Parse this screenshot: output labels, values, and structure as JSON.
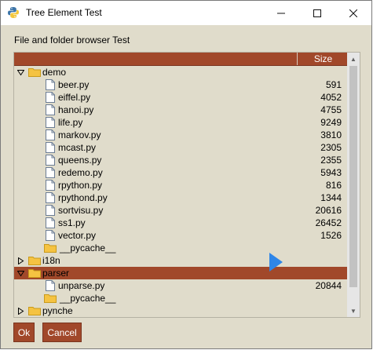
{
  "window": {
    "title": "Tree Element Test",
    "icon": "python-icon",
    "controls": {
      "minimize": "─",
      "maximize": "☐",
      "close": "✕"
    }
  },
  "header_text": "File and folder browser Test",
  "tree": {
    "columns": {
      "size": "Size"
    },
    "rows": [
      {
        "name": "demo",
        "type": "folder",
        "level": 0,
        "expanded": true,
        "size": ""
      },
      {
        "name": "beer.py",
        "type": "file",
        "level": 1,
        "size": "591"
      },
      {
        "name": "eiffel.py",
        "type": "file",
        "level": 1,
        "size": "4052"
      },
      {
        "name": "hanoi.py",
        "type": "file",
        "level": 1,
        "size": "4755"
      },
      {
        "name": "life.py",
        "type": "file",
        "level": 1,
        "size": "9249"
      },
      {
        "name": "markov.py",
        "type": "file",
        "level": 1,
        "size": "3810"
      },
      {
        "name": "mcast.py",
        "type": "file",
        "level": 1,
        "size": "2305"
      },
      {
        "name": "queens.py",
        "type": "file",
        "level": 1,
        "size": "2355"
      },
      {
        "name": "redemo.py",
        "type": "file",
        "level": 1,
        "size": "5943"
      },
      {
        "name": "rpython.py",
        "type": "file",
        "level": 1,
        "size": "816"
      },
      {
        "name": "rpythond.py",
        "type": "file",
        "level": 1,
        "size": "1344"
      },
      {
        "name": "sortvisu.py",
        "type": "file",
        "level": 1,
        "size": "20616"
      },
      {
        "name": "ss1.py",
        "type": "file",
        "level": 1,
        "size": "26452"
      },
      {
        "name": "vector.py",
        "type": "file",
        "level": 1,
        "size": "1526"
      },
      {
        "name": "__pycache__",
        "type": "folder",
        "level": 1,
        "size": ""
      },
      {
        "name": "i18n",
        "type": "folder",
        "level": 0,
        "expanded": false,
        "size": ""
      },
      {
        "name": "parser",
        "type": "folder",
        "level": 0,
        "expanded": true,
        "size": "",
        "selected": true
      },
      {
        "name": "unparse.py",
        "type": "file",
        "level": 1,
        "size": "20844"
      },
      {
        "name": "__pycache__",
        "type": "folder",
        "level": 1,
        "size": ""
      },
      {
        "name": "pynche",
        "type": "folder",
        "level": 0,
        "expanded": false,
        "size": ""
      }
    ]
  },
  "buttons": {
    "ok": "Ok",
    "cancel": "Cancel"
  },
  "colors": {
    "accent": "#a1482a",
    "background": "#e0dccb",
    "folder": "#f5c342"
  }
}
